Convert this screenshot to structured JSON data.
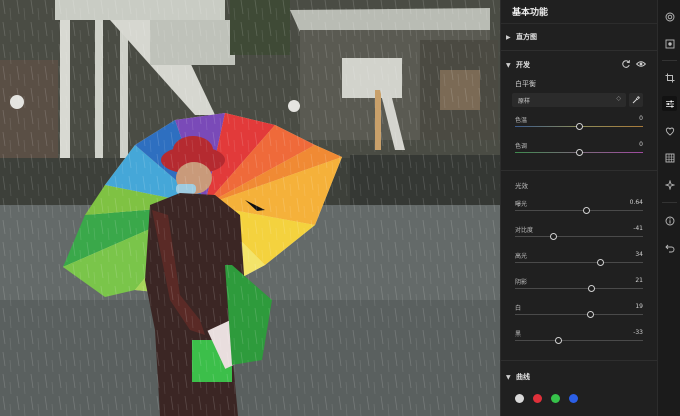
{
  "panel": {
    "title": "基本功能",
    "histogram": {
      "label": "直方图",
      "chevron": "▶"
    },
    "develop": {
      "label": "开发",
      "chevron": "▼"
    },
    "white_balance": {
      "label": "白平衡",
      "preset": "原样",
      "caret": "◇",
      "sliders": [
        {
          "label": "色温",
          "value": "0",
          "level": 0.5
        },
        {
          "label": "色调",
          "value": "0",
          "level": 0.5
        }
      ]
    },
    "light": {
      "label": "光效",
      "sliders": [
        {
          "label": "曝光",
          "value": "0.64",
          "level": 0.56
        },
        {
          "label": "对比度",
          "value": "-41",
          "level": 0.3
        },
        {
          "label": "高光",
          "value": "34",
          "level": 0.67
        },
        {
          "label": "阴影",
          "value": "21",
          "level": 0.6
        },
        {
          "label": "白",
          "value": "19",
          "level": 0.59
        },
        {
          "label": "黑",
          "value": "-33",
          "level": 0.34
        }
      ]
    },
    "curves": {
      "label": "曲线",
      "chevron": "▼",
      "channels": [
        "#d9d9d9",
        "#e0303a",
        "#36c24a",
        "#2b5fe6"
      ]
    }
  },
  "tools": [
    "filter-icon",
    "crop-overlay-icon",
    "crop-icon",
    "adjust-sliders-icon",
    "heal-icon",
    "grid-icon",
    "sparkle-icon",
    "info-icon",
    "undo-icon"
  ]
}
